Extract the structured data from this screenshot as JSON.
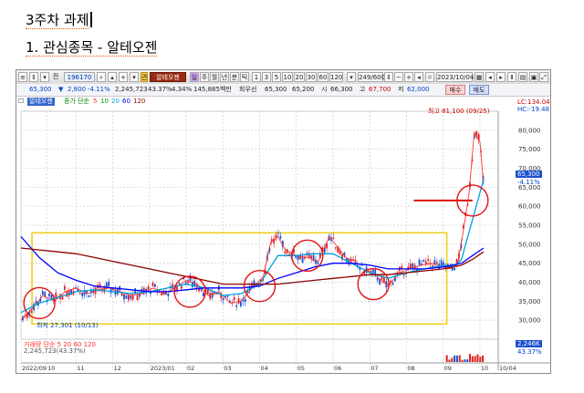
{
  "document": {
    "heading": "3주차 과제",
    "subheading": "1. 관심종목 - 알테오젠"
  },
  "toolbar": {
    "code": "196170",
    "stock_name": "알테오젠",
    "periods": [
      "일",
      "주",
      "월",
      "년",
      "분",
      "틱"
    ],
    "intervals": [
      "1",
      "3",
      "5",
      "10",
      "20",
      "30",
      "60",
      "120"
    ],
    "count": "249/600",
    "date": "2023/10/04"
  },
  "quote": {
    "price": "65,300",
    "change": "2,800",
    "change_pct": "-4.11%",
    "volume": "2,245,723",
    "volume_ratio": "43.37%",
    "turnover_pct": "4.34%",
    "amount": "145,885백만",
    "avg_label": "회우선",
    "open_value": "65,300",
    "low_value": "65,200",
    "prev_label": "시",
    "prev_value": "66,300",
    "high_label": "고",
    "high_value": "67,700",
    "low_label": "저",
    "low2_value": "62,000",
    "buy_label": "매수",
    "sell_label": "매도"
  },
  "ma_legend": {
    "name": "알테오젠",
    "type": "종가 단순",
    "periods": [
      "5",
      "10",
      "20",
      "60",
      "120"
    ],
    "colors": [
      "#ff3333",
      "#00a000",
      "#00a0e0",
      "#0000ff",
      "#8b0000"
    ]
  },
  "annotations": {
    "max_label": "최고 81,100 (09/25)",
    "min_label": "최저 27,301 (10/13)",
    "lc": "LC:134.04",
    "hc": "HC:-19.48",
    "current_price": "65,300",
    "current_pct": "-4.11%",
    "volume_badge": "2,246K",
    "volume_pct": "43.37%",
    "volume_legend": "거래량 단순 5 20 60 120",
    "volume_value": "2,245,723(43.37%)"
  },
  "chart_data": {
    "type": "line",
    "title": "",
    "xlabel": "",
    "ylabel": "",
    "ylim": [
      25000,
      85000
    ],
    "y_ticks": [
      30000,
      35000,
      40000,
      45000,
      50000,
      55000,
      60000,
      65000,
      70000,
      75000,
      80000
    ],
    "y_tick_labels": [
      "30,000",
      "35,000",
      "40,000",
      "45,000",
      "50,000",
      "55,000",
      "60,000",
      "65,000",
      "70,000",
      "75,000",
      "80,000"
    ],
    "x_labels": [
      "2022/09",
      "10",
      "11",
      "12",
      "2023/01",
      "02",
      "03",
      "04",
      "05",
      "06",
      "07",
      "08",
      "09",
      "10",
      "10/04"
    ],
    "x_label_positions": [
      0,
      0.7,
      1.5,
      2.5,
      3.5,
      4.5,
      5.5,
      6.5,
      7.5,
      8.5,
      9.5,
      10.5,
      11.5,
      12.5,
      13.0
    ],
    "xlim": [
      0,
      13.0
    ],
    "series": [
      {
        "name": "5",
        "color": "#ff3333",
        "x": [
          0,
          0.3,
          0.6,
          0.9,
          1.2,
          1.5,
          1.8,
          2.1,
          2.4,
          2.7,
          3.0,
          3.3,
          3.6,
          3.9,
          4.2,
          4.5,
          4.8,
          5.1,
          5.4,
          5.7,
          6.0,
          6.3,
          6.6,
          6.8,
          7.0,
          7.2,
          7.5,
          7.8,
          8.1,
          8.4,
          8.6,
          8.8,
          9.1,
          9.4,
          9.7,
          10.0,
          10.3,
          10.6,
          10.9,
          11.2,
          11.5,
          11.7,
          11.9,
          12.05,
          12.2,
          12.35,
          12.5,
          12.6
        ],
        "y": [
          30000,
          33000,
          36500,
          35000,
          37500,
          38500,
          37000,
          38000,
          38500,
          37500,
          36500,
          37000,
          38500,
          37000,
          38500,
          40500,
          39500,
          36500,
          37500,
          34500,
          35000,
          38500,
          41500,
          50500,
          52000,
          48500,
          47000,
          46500,
          45500,
          52000,
          49500,
          47000,
          44500,
          43000,
          41500,
          39000,
          42500,
          43500,
          44500,
          45000,
          44000,
          43500,
          45000,
          53500,
          63000,
          79500,
          77000,
          66000
        ]
      },
      {
        "name": "20",
        "color": "#00a0e0",
        "x": [
          0,
          0.5,
          1.0,
          1.5,
          2.0,
          2.5,
          3.0,
          3.5,
          4.0,
          4.5,
          5.0,
          5.5,
          6.0,
          6.5,
          7.0,
          7.5,
          8.0,
          8.5,
          9.0,
          9.5,
          10.0,
          10.5,
          11.0,
          11.5,
          11.8,
          12.0,
          12.2,
          12.4,
          12.6
        ],
        "y": [
          32000,
          34500,
          36000,
          37500,
          38000,
          37500,
          37000,
          37500,
          38500,
          39500,
          38500,
          36500,
          37000,
          39500,
          47000,
          47000,
          47500,
          47500,
          45000,
          42500,
          41000,
          42500,
          43500,
          44500,
          44000,
          46000,
          53000,
          60000,
          67000
        ]
      },
      {
        "name": "60",
        "color": "#0000ff",
        "x": [
          0,
          0.5,
          1.0,
          1.5,
          2.0,
          2.5,
          3.0,
          3.5,
          4.0,
          4.5,
          5.0,
          5.5,
          6.0,
          6.5,
          7.0,
          7.5,
          8.0,
          8.5,
          9.0,
          9.5,
          10.0,
          10.5,
          11.0,
          11.5,
          12.0,
          12.3,
          12.6
        ],
        "y": [
          52000,
          46500,
          42500,
          40500,
          39000,
          38500,
          38000,
          37500,
          37500,
          38000,
          38500,
          38500,
          38500,
          39000,
          41000,
          42500,
          44000,
          45000,
          45000,
          44500,
          43500,
          43500,
          43500,
          44000,
          45000,
          47000,
          49000
        ]
      },
      {
        "name": "120",
        "color": "#8b0000",
        "x": [
          0,
          0.5,
          1.0,
          1.5,
          2.0,
          2.5,
          3.0,
          3.5,
          4.0,
          4.5,
          5.0,
          5.5,
          6.0,
          6.5,
          7.0,
          7.5,
          8.0,
          8.5,
          9.0,
          9.5,
          10.0,
          10.5,
          11.0,
          11.5,
          12.0,
          12.3,
          12.6
        ],
        "y": [
          49000,
          48500,
          48000,
          47500,
          46500,
          45500,
          44500,
          43500,
          42500,
          41500,
          40500,
          39500,
          39500,
          39500,
          39500,
          40000,
          40500,
          41000,
          41500,
          42000,
          42000,
          42500,
          43000,
          43500,
          44500,
          46000,
          48000
        ]
      }
    ],
    "highlight_box": {
      "x": [
        0.3,
        11.6
      ],
      "y": [
        29000,
        53000
      ]
    },
    "target_line": {
      "x": [
        10.7,
        12.3
      ],
      "y": 61500
    },
    "circles": [
      {
        "x": 0.5,
        "y": 34500
      },
      {
        "x": 4.6,
        "y": 37500
      },
      {
        "x": 6.5,
        "y": 39000
      },
      {
        "x": 7.8,
        "y": 47000
      },
      {
        "x": 9.6,
        "y": 39500
      },
      {
        "x": 12.3,
        "y": 61500
      }
    ],
    "grid": true,
    "legend": "top-left"
  }
}
